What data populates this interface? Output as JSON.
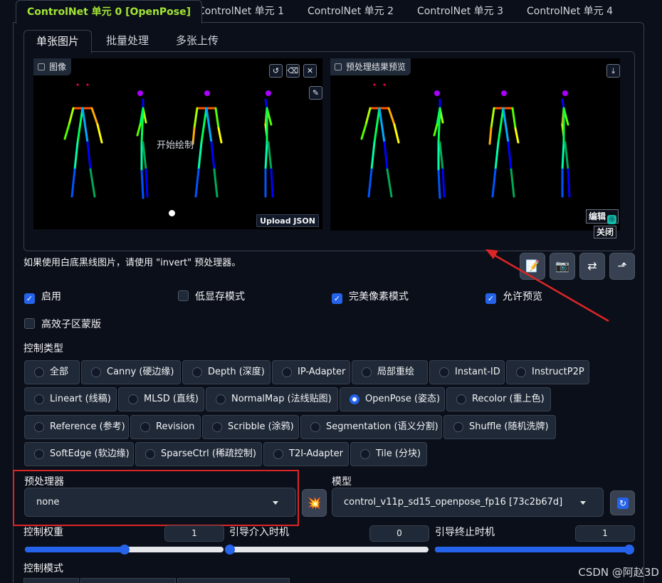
{
  "unit_tabs": [
    {
      "label": "ControlNet 单元 0 [OpenPose]",
      "active": true
    },
    {
      "label": "ControlNet 单元 1"
    },
    {
      "label": "ControlNet 单元 2"
    },
    {
      "label": "ControlNet 单元 3"
    },
    {
      "label": "ControlNet 单元 4"
    }
  ],
  "sub_tabs": [
    {
      "label": "单张图片",
      "active": true
    },
    {
      "label": "批量处理"
    },
    {
      "label": "多张上传"
    }
  ],
  "image_panel": {
    "input_label": "图像",
    "input_hint": "开始绘制",
    "upload_json": "Upload JSON",
    "preview_label": "预处理结果预览",
    "edit_label": "编辑",
    "close_label": "关闭"
  },
  "invert_hint": "如果使用白底黑线图片，请使用 \"invert\" 预处理器。",
  "checkboxes": [
    {
      "label": "启用",
      "checked": true
    },
    {
      "label": "低显存模式",
      "checked": false
    },
    {
      "label": "完美像素模式",
      "checked": true
    },
    {
      "label": "允许预览",
      "checked": true
    },
    {
      "label": "高效子区蒙版",
      "checked": false
    }
  ],
  "control_type": {
    "label": "控制类型",
    "options": [
      "全部",
      "Canny (硬边缘)",
      "Depth (深度)",
      "IP-Adapter",
      "局部重绘",
      "Instant-ID",
      "InstructP2P",
      "Lineart (线稿)",
      "MLSD (直线)",
      "NormalMap (法线贴图)",
      "OpenPose (姿态)",
      "Recolor (重上色)",
      "Reference (参考)",
      "Revision",
      "Scribble (涂鸦)",
      "Segmentation (语义分割)",
      "Shuffle (随机洗牌)",
      "SoftEdge (软边缘)",
      "SparseCtrl (稀疏控制)",
      "T2I-Adapter",
      "Tile (分块)"
    ],
    "selected": "OpenPose (姿态)"
  },
  "preprocessor": {
    "label": "预处理器",
    "value": "none"
  },
  "model": {
    "label": "模型",
    "value": "control_v11p_sd15_openpose_fp16 [73c2b67d]"
  },
  "sliders": [
    {
      "label": "控制权重",
      "value": "1",
      "fraction": 0.5
    },
    {
      "label": "引导介入时机",
      "value": "0",
      "fraction": 0.0
    },
    {
      "label": "引导终止时机",
      "value": "1",
      "fraction": 1.0
    }
  ],
  "control_mode": {
    "label": "控制模式"
  },
  "watermark": "CSDN @阿赵3D",
  "colors": {
    "accent": "#2563eb",
    "active_tab": "#a3e635",
    "annotation": "#dc2626",
    "panel": "#1f2937",
    "background": "#0b0f19"
  },
  "icons": [
    "image-icon",
    "undo-icon",
    "eraser-icon",
    "close-icon",
    "brush-icon",
    "download-icon",
    "document-icon",
    "camera-icon",
    "swap-icon",
    "send-icon",
    "explode-icon",
    "refresh-icon",
    "dropdown-chevron-icon"
  ]
}
